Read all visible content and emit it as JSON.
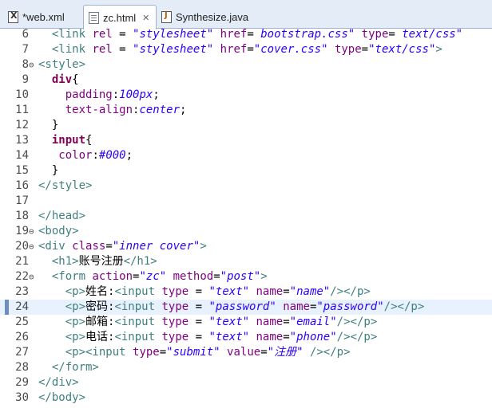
{
  "tabs": [
    {
      "label": "*web.xml",
      "icon": "xml-file-icon",
      "active": false,
      "close": ""
    },
    {
      "label": "zc.html",
      "icon": "html-file-icon",
      "active": true,
      "close": "✕"
    },
    {
      "label": "Synthesize.java",
      "icon": "java-file-icon",
      "active": false,
      "close": ""
    }
  ],
  "editor": {
    "current_line": 24,
    "lines": [
      {
        "num": "6",
        "fold": "",
        "html": "  <span class=\"t\">&lt;link</span> <span class=\"a\">rel</span> = <span class=\"v\">\"stylesheet\"</span> <span class=\"a\">href</span>= <span class=\"v\">bootstrap.css\"</span> <span class=\"a\">type</span>= <span class=\"v\">text/css\"</span>"
      },
      {
        "num": "7",
        "fold": "",
        "html": "  <span class=\"t\">&lt;link</span> <span class=\"a\">rel</span> = <span class=\"v\">\"stylesheet\"</span> <span class=\"a\">href</span>=<span class=\"v\">\"cover.css\"</span> <span class=\"a\">type</span>=<span class=\"v\">\"text/css\"</span><span class=\"t\">&gt;</span>"
      },
      {
        "num": "8",
        "fold": "⊖",
        "html": "<span class=\"t\">&lt;style&gt;</span>"
      },
      {
        "num": "9",
        "fold": "",
        "html": "  <span class=\"k\">div</span>{"
      },
      {
        "num": "10",
        "fold": "",
        "html": "    <span class=\"s\">padding</span>:<span class=\"n\">100px</span>;"
      },
      {
        "num": "11",
        "fold": "",
        "html": "    <span class=\"s\">text-align</span>:<span class=\"n\">center</span>;"
      },
      {
        "num": "12",
        "fold": "",
        "html": "  }"
      },
      {
        "num": "13",
        "fold": "",
        "html": "  <span class=\"k\">input</span>{"
      },
      {
        "num": "14",
        "fold": "",
        "html": "   <span class=\"s\">color</span>:<span class=\"n\">#000</span>;"
      },
      {
        "num": "15",
        "fold": "",
        "html": "  }"
      },
      {
        "num": "16",
        "fold": "",
        "html": "<span class=\"t\">&lt;/style&gt;</span>"
      },
      {
        "num": "17",
        "fold": "",
        "html": ""
      },
      {
        "num": "18",
        "fold": "",
        "html": "<span class=\"t\">&lt;/head&gt;</span>"
      },
      {
        "num": "19",
        "fold": "⊖",
        "html": "<span class=\"t\">&lt;body&gt;</span>"
      },
      {
        "num": "20",
        "fold": "⊖",
        "html": "<span class=\"t\">&lt;div</span> <span class=\"a\">class</span>=<span class=\"v\">\"inner cover\"</span><span class=\"t\">&gt;</span>"
      },
      {
        "num": "21",
        "fold": "",
        "html": "  <span class=\"t\">&lt;h1&gt;</span><span class=\"txt\">账号注册</span><span class=\"t\">&lt;/h1&gt;</span>"
      },
      {
        "num": "22",
        "fold": "⊖",
        "html": "  <span class=\"t\">&lt;form</span> <span class=\"a\">action</span>=<span class=\"v\">\"zc\"</span> <span class=\"a\">method</span>=<span class=\"v\">\"post\"</span><span class=\"t\">&gt;</span>"
      },
      {
        "num": "23",
        "fold": "",
        "html": "    <span class=\"t\">&lt;p&gt;</span><span class=\"txt\">姓名:</span><span class=\"t\">&lt;input</span> <span class=\"a\">type</span> = <span class=\"v\">\"text\"</span> <span class=\"a\">name</span>=<span class=\"v\">\"name\"</span><span class=\"t\">/&gt;&lt;/p&gt;</span>"
      },
      {
        "num": "24",
        "fold": "",
        "html": "    <span class=\"t\">&lt;p&gt;</span><span class=\"txt\">密码:</span><span class=\"t\">&lt;input</span> <span class=\"a\">type</span> = <span class=\"v\">\"password\"</span> <span class=\"a\">name</span>=<span class=\"v\">\"password\"</span><span class=\"t\">/&gt;&lt;/p&gt;</span>"
      },
      {
        "num": "25",
        "fold": "",
        "html": "    <span class=\"t\">&lt;p&gt;</span><span class=\"txt\">邮箱:</span><span class=\"t\">&lt;input</span> <span class=\"a\">type</span> = <span class=\"v\">\"text\"</span> <span class=\"a\">name</span>=<span class=\"v\">\"email\"</span><span class=\"t\">/&gt;&lt;/p&gt;</span>"
      },
      {
        "num": "26",
        "fold": "",
        "html": "    <span class=\"t\">&lt;p&gt;</span><span class=\"txt\">电话:</span><span class=\"t\">&lt;input</span> <span class=\"a\">type</span> = <span class=\"v\">\"text\"</span> <span class=\"a\">name</span>=<span class=\"v\">\"phone\"</span><span class=\"t\">/&gt;&lt;/p&gt;</span>"
      },
      {
        "num": "27",
        "fold": "",
        "html": "    <span class=\"t\">&lt;p&gt;&lt;input</span> <span class=\"a\">type</span>=<span class=\"v\">\"submit\"</span> <span class=\"a\">value</span>=<span class=\"v\">\"注册\"</span> <span class=\"t\">/&gt;&lt;/p&gt;</span>"
      },
      {
        "num": "28",
        "fold": "",
        "html": "  <span class=\"t\">&lt;/form&gt;</span>"
      },
      {
        "num": "29",
        "fold": "",
        "html": "<span class=\"t\">&lt;/div&gt;</span>"
      },
      {
        "num": "30",
        "fold": "",
        "html": "<span class=\"t\">&lt;/body&gt;</span>"
      }
    ]
  }
}
